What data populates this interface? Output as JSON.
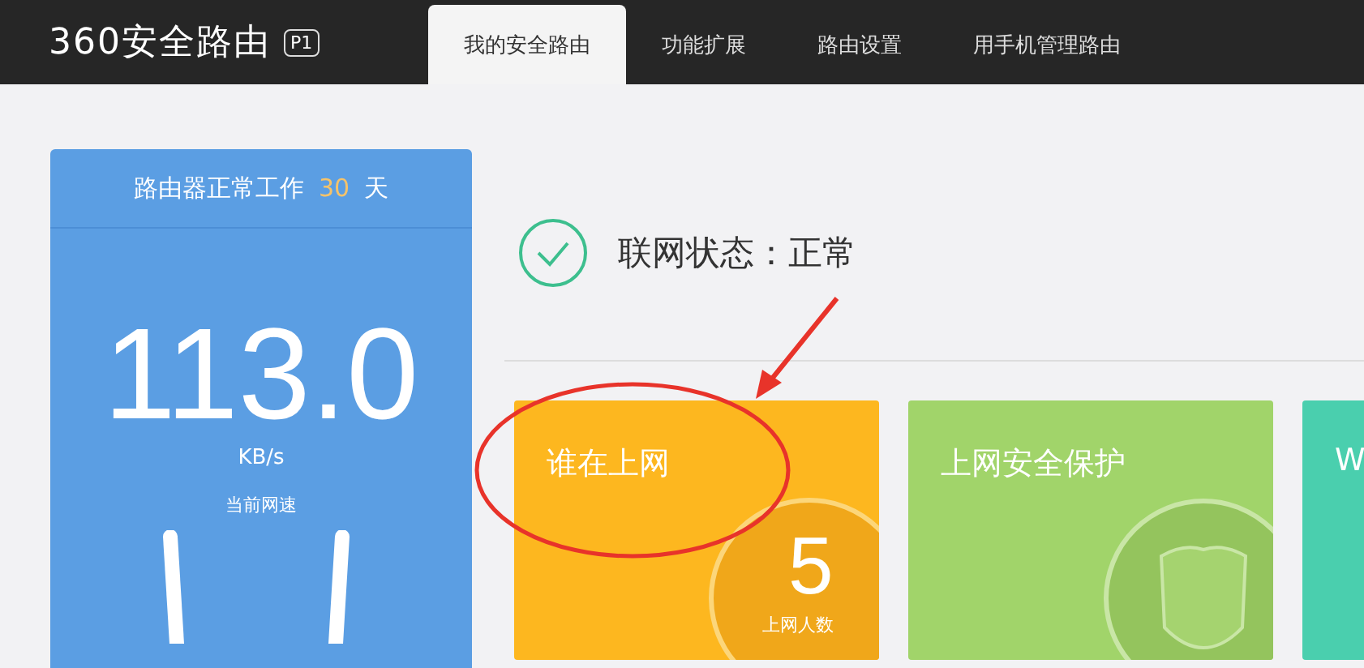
{
  "header": {
    "logo": "360安全路由",
    "model_badge": "P1"
  },
  "tabs": [
    {
      "label": "我的安全路由",
      "selected": true
    },
    {
      "label": "功能扩展",
      "selected": false
    },
    {
      "label": "路由设置",
      "selected": false
    },
    {
      "label": "用手机管理路由",
      "selected": false
    }
  ],
  "speed_card": {
    "uptime_prefix": "路由器正常工作",
    "uptime_days": "30",
    "uptime_suffix": "天",
    "speed": "113.0",
    "unit": "KB/s",
    "caption": "当前网速"
  },
  "status": {
    "text": "联网状态：正常"
  },
  "tiles": [
    {
      "kind": "count",
      "title": "谁在上网",
      "color": "#fdb71f",
      "count": "5",
      "count_label": "上网人数"
    },
    {
      "kind": "shield",
      "title": "上网安全保护",
      "color": "#a1d46a"
    },
    {
      "kind": "plain",
      "title": "W",
      "color": "#4acfae"
    }
  ]
}
